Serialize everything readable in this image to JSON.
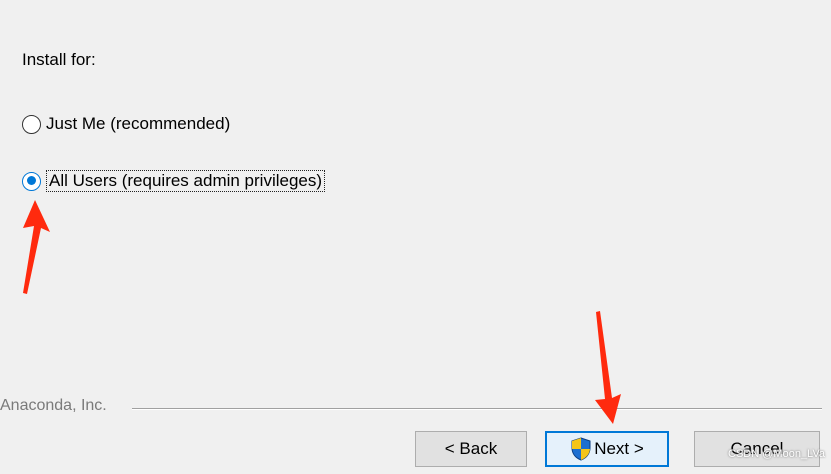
{
  "installer": {
    "prompt": "Install for:",
    "options": [
      {
        "label": "Just Me (recommended)",
        "selected": false
      },
      {
        "label": "All Users (requires admin privileges)",
        "selected": true
      }
    ],
    "brand": "Anaconda, Inc."
  },
  "buttons": {
    "back": "< Back",
    "next": "Next >",
    "cancel": "Cancel"
  },
  "watermark": "CSDN @Moon_LVa",
  "colors": {
    "accent": "#0078d7",
    "annotation_arrow": "#ff2a0e",
    "shield_blue": "#1d6fd1",
    "shield_gold": "#f5c518"
  },
  "icons": {
    "next_button_icon": "uac-shield-icon",
    "annotations": "red-arrow-icon"
  }
}
